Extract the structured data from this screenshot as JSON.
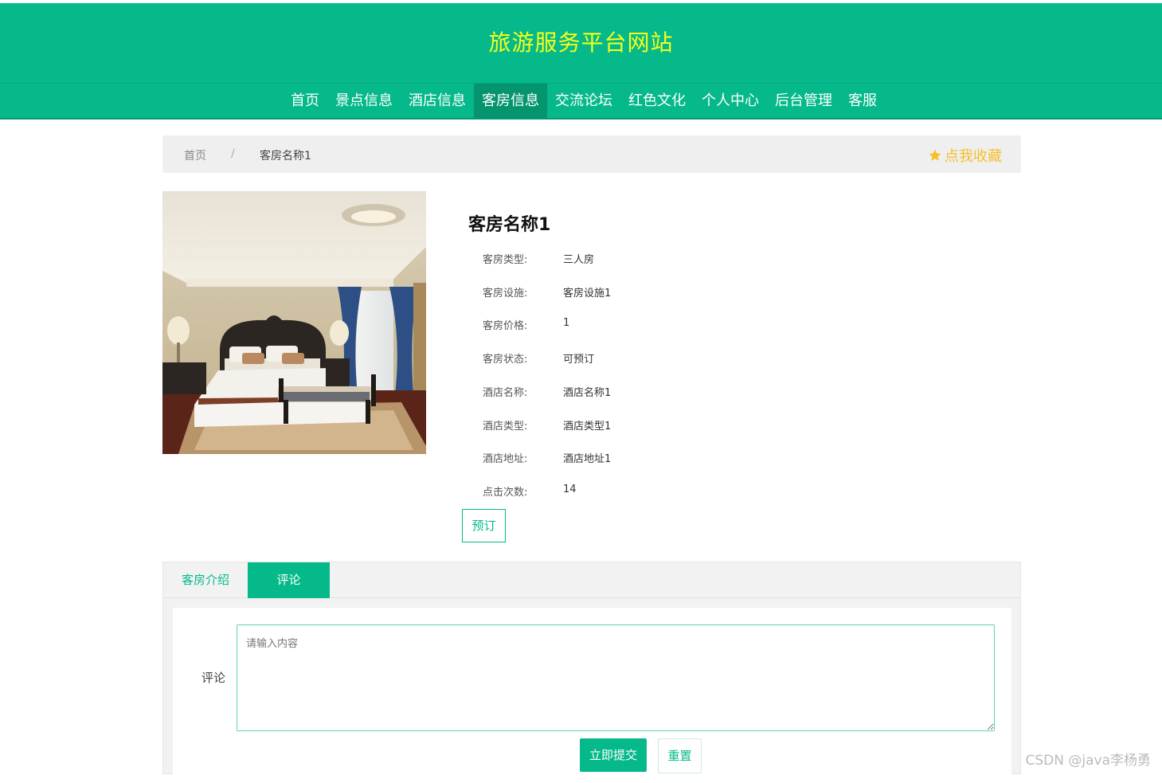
{
  "header": {
    "site_title": "旅游服务平台网站"
  },
  "nav": {
    "items": [
      {
        "label": "首页",
        "active": false
      },
      {
        "label": "景点信息",
        "active": false
      },
      {
        "label": "酒店信息",
        "active": false
      },
      {
        "label": "客房信息",
        "active": true
      },
      {
        "label": "交流论坛",
        "active": false
      },
      {
        "label": "红色文化",
        "active": false
      },
      {
        "label": "个人中心",
        "active": false
      },
      {
        "label": "后台管理",
        "active": false
      },
      {
        "label": "客服",
        "active": false
      }
    ]
  },
  "breadcrumb": {
    "home": "首页",
    "separator": "/",
    "current": "客房名称1"
  },
  "favorite": {
    "label": "点我收藏",
    "icon": "star-icon",
    "color": "#f5c02a"
  },
  "room": {
    "name": "客房名称1",
    "fields": [
      {
        "label": "客房类型:",
        "value": "三人房"
      },
      {
        "label": "客房设施:",
        "value": "客房设施1"
      },
      {
        "label": "客房价格:",
        "value": "1"
      },
      {
        "label": "客房状态:",
        "value": "可预订"
      },
      {
        "label": "酒店名称:",
        "value": "酒店名称1"
      },
      {
        "label": "酒店类型:",
        "value": "酒店类型1"
      },
      {
        "label": "酒店地址:",
        "value": "酒店地址1"
      },
      {
        "label": "点击次数:",
        "value": "14"
      }
    ],
    "book_label": "预订"
  },
  "tabs": {
    "intro": "客房介绍",
    "comment": "评论",
    "active": "comment"
  },
  "comment_form": {
    "label": "评论",
    "placeholder": "请输入内容",
    "submit_label": "立即提交",
    "reset_label": "重置"
  },
  "watermark": "CSDN @java李杨勇",
  "colors": {
    "primary": "#05b98a",
    "title_yellow": "#f7ff1a"
  }
}
